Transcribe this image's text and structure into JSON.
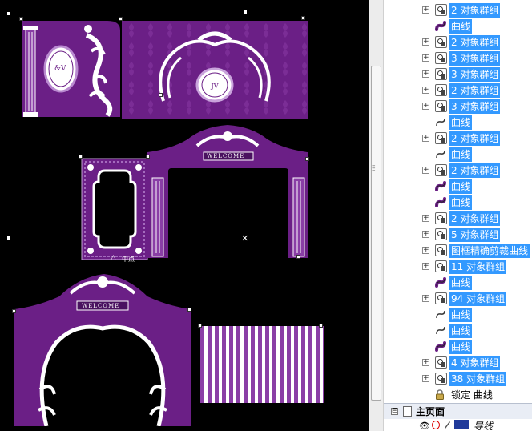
{
  "canvas": {
    "background": "#000000",
    "purple": "#6b1f86",
    "dark_purple": "#4a1260",
    "light_purple": "#8a3ea6",
    "monogram": "&V",
    "welcome_top": "WELCOME",
    "welcome_bottom": "WELCOME",
    "center_label": "中点"
  },
  "objects_panel": {
    "items": [
      {
        "kind": "group",
        "label": "2 对象群组",
        "selected": true,
        "expandable": true
      },
      {
        "kind": "curve",
        "label": "曲线",
        "selected": true,
        "expandable": false
      },
      {
        "kind": "group",
        "label": "2 对象群组",
        "selected": true,
        "expandable": true
      },
      {
        "kind": "group",
        "label": "3 对象群组",
        "selected": true,
        "expandable": true
      },
      {
        "kind": "group",
        "label": "3 对象群组",
        "selected": true,
        "expandable": true
      },
      {
        "kind": "group",
        "label": "2 对象群组",
        "selected": true,
        "expandable": true
      },
      {
        "kind": "group",
        "label": "3 对象群组",
        "selected": true,
        "expandable": true
      },
      {
        "kind": "curve-outline",
        "label": "曲线",
        "selected": true,
        "expandable": false
      },
      {
        "kind": "group",
        "label": "2 对象群组",
        "selected": true,
        "expandable": true
      },
      {
        "kind": "curve-outline",
        "label": "曲线",
        "selected": true,
        "expandable": false
      },
      {
        "kind": "group",
        "label": "2 对象群组",
        "selected": true,
        "expandable": true
      },
      {
        "kind": "curve",
        "label": "曲线",
        "selected": true,
        "expandable": false
      },
      {
        "kind": "curve",
        "label": "曲线",
        "selected": true,
        "expandable": false
      },
      {
        "kind": "group",
        "label": "2 对象群组",
        "selected": true,
        "expandable": true
      },
      {
        "kind": "group",
        "label": "5 对象群组",
        "selected": true,
        "expandable": true
      },
      {
        "kind": "powerclip",
        "label": "图框精确剪裁曲线",
        "selected": true,
        "expandable": true
      },
      {
        "kind": "group",
        "label": "11 对象群组",
        "selected": true,
        "expandable": true
      },
      {
        "kind": "curve",
        "label": "曲线",
        "selected": true,
        "expandable": false
      },
      {
        "kind": "group",
        "label": "94 对象群组",
        "selected": true,
        "expandable": true
      },
      {
        "kind": "curve-outline",
        "label": "曲线",
        "selected": true,
        "expandable": false
      },
      {
        "kind": "curve-outline",
        "label": "曲线",
        "selected": true,
        "expandable": false
      },
      {
        "kind": "curve",
        "label": "曲线",
        "selected": true,
        "expandable": false
      },
      {
        "kind": "group",
        "label": "4 对象群组",
        "selected": true,
        "expandable": true
      },
      {
        "kind": "group",
        "label": "38 对象群组",
        "selected": true,
        "expandable": true
      },
      {
        "kind": "locked",
        "label": "锁定 曲线",
        "selected": false,
        "expandable": false
      }
    ],
    "master_page": {
      "label": "主页面",
      "expand": "⊟"
    },
    "guides_layer": {
      "label": "导线",
      "color": "#203a9a"
    }
  }
}
